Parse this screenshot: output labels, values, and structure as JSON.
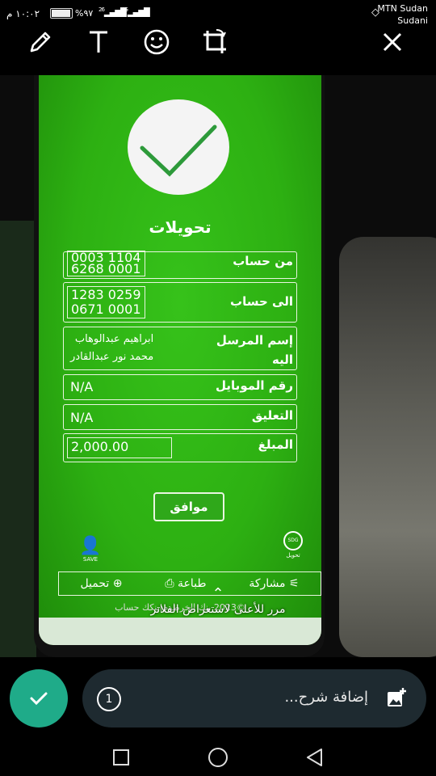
{
  "status_bar": {
    "time": "١٠:٠٢ م",
    "battery": "%٩٧",
    "signal1": "26",
    "signal2": "4G",
    "carrier_line1": "MTN Sudan",
    "carrier_line2": "Sudani"
  },
  "toolbar": {
    "tools": [
      "pencil-icon",
      "text-icon",
      "emoji-icon",
      "crop-rotate-icon"
    ],
    "close": "close-icon"
  },
  "photo": {
    "heading": "تحويلات",
    "rows": [
      {
        "label": "من حساب",
        "value": "0003 1104\n6268 0001"
      },
      {
        "label": "الى حساب",
        "value": "1283 0259\n0671 0001"
      },
      {
        "label": "إسم المرسل اليه",
        "value": "ابراهيم عبدالوهاب\nمحمد نور عبدالقادر"
      },
      {
        "label": "رقم الموبايل",
        "value": "N/A"
      },
      {
        "label": "التعليق",
        "value": "N/A"
      },
      {
        "label": "المبلغ",
        "value": "2,000.00"
      }
    ],
    "ok_button": "موافق",
    "save_label": "SAVE",
    "transfer_label": "تحويل",
    "footer_share": "مشاركة",
    "footer_print": "طباعة",
    "footer_download": "تحميل",
    "copyright": "©2023 بنك الخرطوم|بنكك حساب"
  },
  "swipe_hint": "مرر للأعلى لاستعراض الفلاتر",
  "composer": {
    "caption_placeholder": "إضافة شرح...",
    "timer_label": "1"
  },
  "colors": {
    "send_button": "#1fab89",
    "caption_bg": "#1e2a30",
    "screen_green": "#2db012"
  }
}
